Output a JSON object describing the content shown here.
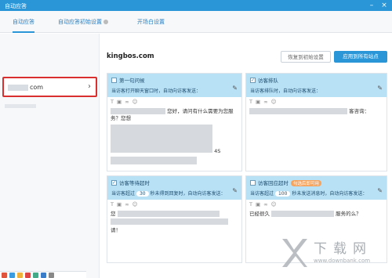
{
  "window": {
    "title": "自动应答"
  },
  "tabs": [
    {
      "label": "自动应答"
    },
    {
      "label": "自动应答初始设置"
    },
    {
      "label": "开场白设置"
    }
  ],
  "sidebar": {
    "site_label": "com"
  },
  "main": {
    "site_title": "kingbos.com",
    "reset_button": "恢复到初始设置",
    "apply_button": "应用到所有站点"
  },
  "cards": [
    {
      "name": "第一句问候",
      "desc": "当访客打开聊天窗口时，自动向访客发送：",
      "body_line1": "您好，请问有什么需要为您服务？您想",
      "body_line2": "4S"
    },
    {
      "name": "访客排队",
      "desc": "当访客排队时，自动向访客发送：",
      "body_line1": "客咨询："
    },
    {
      "name": "访客等待超时",
      "desc_pre": "当访客超过",
      "desc_num": "30",
      "desc_post": "秒未得到回复时，自动向访客发送：",
      "body_line1": "您",
      "body_line2": "请！"
    },
    {
      "name": "访客回应超时",
      "badge": "勾选后即可用",
      "desc_pre": "当访客超过",
      "desc_num": "100",
      "desc_post": "秒未发送消息时，自动向访客发送：",
      "body_line1": "已经很久",
      "body_line2": "服务的么？"
    }
  ],
  "watermark": {
    "big": "下载网",
    "small": "www.downbank.com"
  },
  "colors": {
    "accent": "#2a96d8",
    "card_head": "#b9e1f6",
    "highlight": "#d9302f",
    "badge": "#f5a35d"
  }
}
